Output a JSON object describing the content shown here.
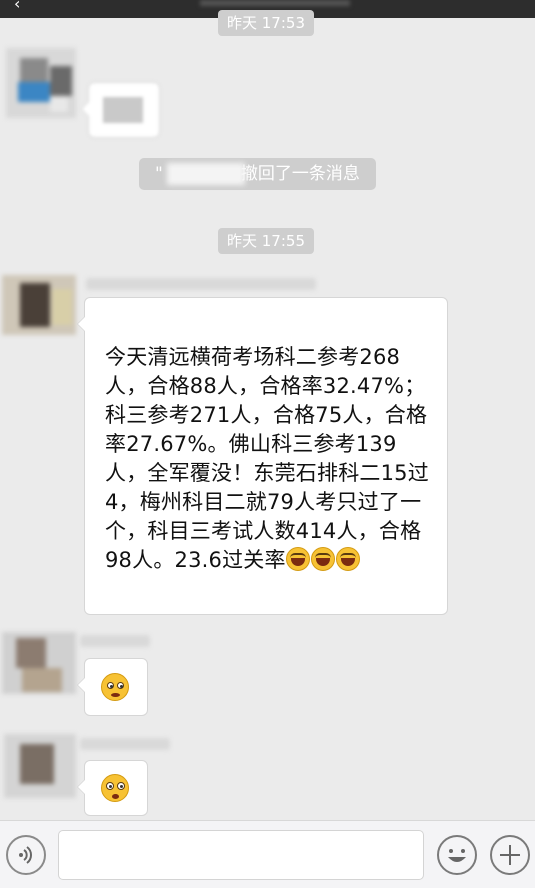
{
  "chat": {
    "timestamp_1": "昨天 17:53",
    "recall_notice": "\"撤回了一条消息",
    "recall_notice_prefix": "\"",
    "recall_notice_suffix": "撤回了一条消息",
    "timestamp_2": "昨天 17:55",
    "message_text": "今天清远横荷考场科二参考268人，合格88人，合格率32.47%；科三参考271人，合格75人，合格率27.67%。佛山科三参考139人，全军覆没！东莞石排科二15过4，梅州科目二就79人考只过了一个，科目三考试人数414人，合格98人。23.6过关率",
    "message_emojis": [
      "laugh-cry-icon",
      "laugh-cry-icon",
      "laugh-cry-icon"
    ],
    "sticker_1": "thinking-face-icon",
    "sticker_2": "flushed-face-icon"
  },
  "input_bar": {
    "voice_icon": "voice-icon",
    "emoji_icon": "smiley-icon",
    "add_icon": "plus-icon",
    "text_value": ""
  },
  "colors": {
    "background": "#ebebeb",
    "bubble": "#ffffff",
    "pill": "#cecece",
    "input_bar": "#f4f4f6"
  }
}
